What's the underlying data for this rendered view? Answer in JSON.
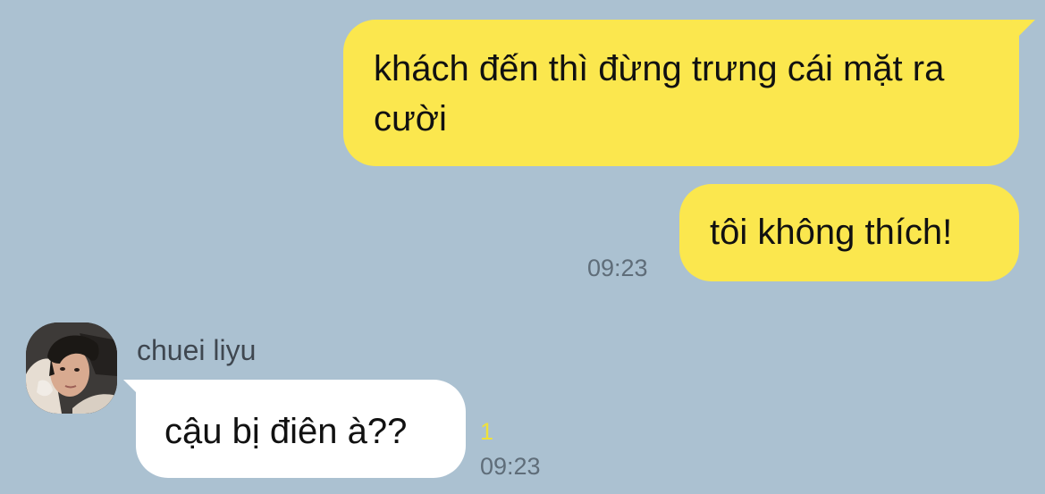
{
  "messages": {
    "outgoing": [
      {
        "text": "khách đến thì đừng trưng cái mặt ra cười"
      },
      {
        "text": "tôi không thích!",
        "time": "09:23"
      }
    ],
    "incoming": [
      {
        "sender": "chuei liyu",
        "text": "cậu bị điên à??",
        "unread": "1",
        "time": "09:23"
      }
    ]
  },
  "colors": {
    "background": "#abc1d1",
    "outgoing_bubble": "#fbe74e",
    "incoming_bubble": "#ffffff",
    "unread_count": "#efe13a"
  },
  "icons": {
    "avatar": "user-photo-avatar"
  }
}
